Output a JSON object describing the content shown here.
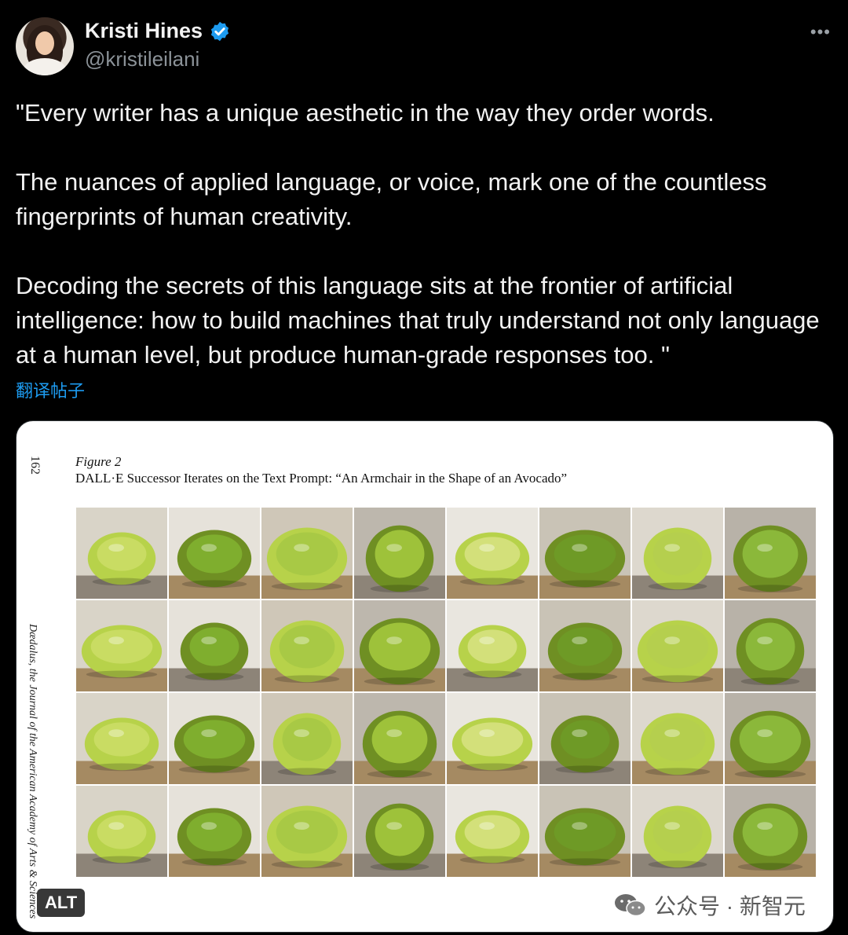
{
  "author": {
    "name": "Kristi Hines",
    "handle": "@kristileilani",
    "verified_icon": "verified-badge-icon"
  },
  "header": {
    "more_label": "•••"
  },
  "tweet": {
    "paragraphs": [
      "\"Every writer has a unique aesthetic in the way they order words.",
      "The nuances of applied language, or voice, mark one of the countless fingerprints of human creativity.",
      "Decoding the secrets of this language sits at the frontier of artificial intelligence: how to build machines that truly understand not only language at a human level, but produce human-grade responses too. \""
    ],
    "translate_label": "翻译帖子"
  },
  "media": {
    "page_number": "162",
    "side_caption": "Dædalus, the Journal of the American Academy of Arts & Sciences",
    "figure_label": "Figure 2",
    "figure_title": "DALL·E Successor Iterates on the Text Prompt: “An Armchair in the Shape of an Avocado”",
    "alt_label": "ALT",
    "watermark": "公众号 · 新智元"
  },
  "colors": {
    "background": "#000000",
    "text": "#f2f2f2",
    "muted": "#8b9298",
    "link": "#1d9bf0",
    "avocado_light": "#b7d24a",
    "avocado_dark": "#6f8f23"
  }
}
